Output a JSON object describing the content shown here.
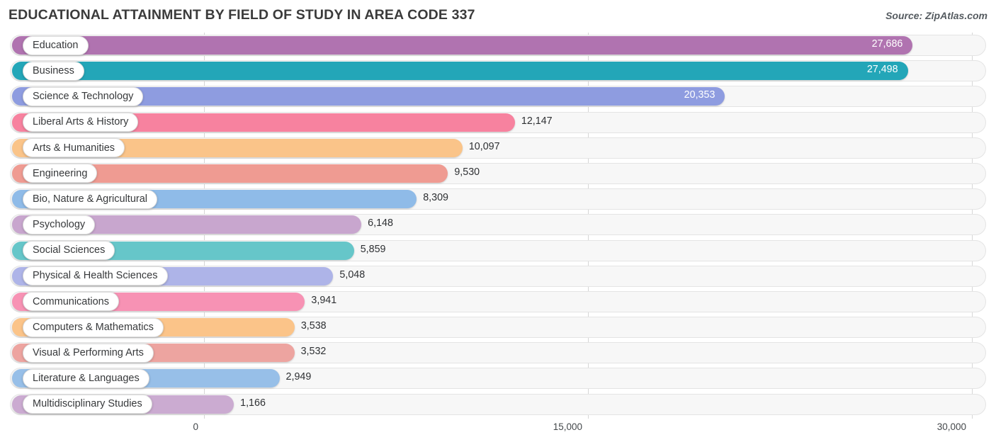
{
  "header": {
    "title": "EDUCATIONAL ATTAINMENT BY FIELD OF STUDY IN AREA CODE 337",
    "source": "Source: ZipAtlas.com"
  },
  "chart_data": {
    "type": "bar",
    "orientation": "horizontal",
    "title": "EDUCATIONAL ATTAINMENT BY FIELD OF STUDY IN AREA CODE 337",
    "xlabel": "",
    "ylabel": "",
    "xlim": [
      0,
      30000
    ],
    "grid": true,
    "legend": "none",
    "axis_ticks": [
      "0",
      "15,000",
      "30,000"
    ],
    "axis_tick_values": [
      0,
      15000,
      30000
    ],
    "categories": [
      "Education",
      "Business",
      "Science & Technology",
      "Liberal Arts & History",
      "Arts & Humanities",
      "Engineering",
      "Bio, Nature & Agricultural",
      "Psychology",
      "Social Sciences",
      "Physical & Health Sciences",
      "Communications",
      "Computers & Mathematics",
      "Visual & Performing Arts",
      "Literature & Languages",
      "Multidisciplinary Studies"
    ],
    "values": [
      27686,
      27498,
      20353,
      12147,
      10097,
      9530,
      8309,
      6148,
      5859,
      5048,
      3941,
      3538,
      3532,
      2949,
      1166
    ],
    "value_labels": [
      "27,686",
      "27,498",
      "20,353",
      "12,147",
      "10,097",
      "9,530",
      "8,309",
      "6,148",
      "5,859",
      "5,048",
      "3,941",
      "3,538",
      "3,532",
      "2,949",
      "1,166"
    ],
    "colors": [
      "#b073b0",
      "#23a6b8",
      "#8e9ce0",
      "#f7829f",
      "#fac489",
      "#ef9b92",
      "#8fbbe8",
      "#c8a6ce",
      "#66c6c9",
      "#aeb4e8",
      "#f792b4",
      "#fbc489",
      "#eda4a0",
      "#97bfe8",
      "#cbabd1"
    ],
    "label_inside": [
      true,
      true,
      true,
      false,
      false,
      false,
      false,
      false,
      false,
      false,
      false,
      false,
      false,
      false,
      false
    ]
  }
}
